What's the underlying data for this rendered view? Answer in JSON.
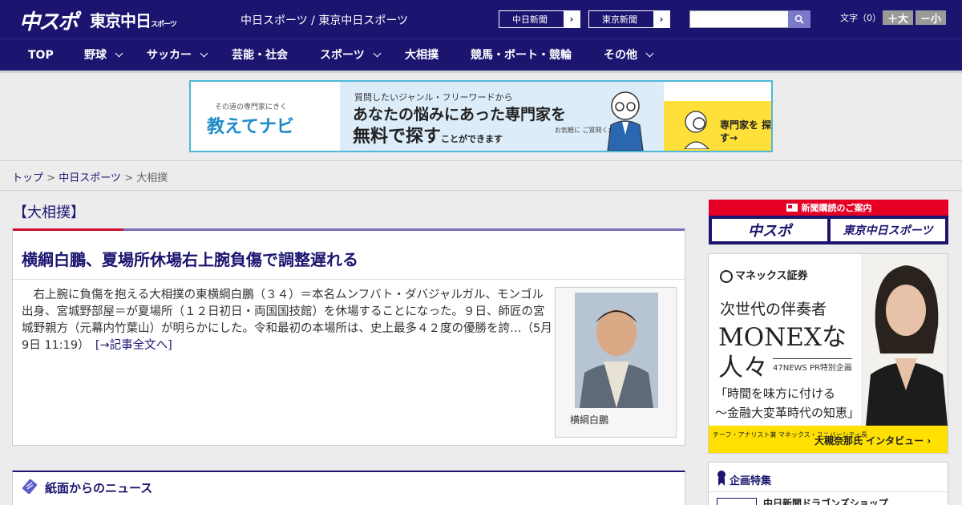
{
  "header": {
    "logo_main": "中スポ",
    "logo_tokyo": "東京中日",
    "logo_tokyo_sub": "スポーツ",
    "site_names": "中日スポーツ / 東京中日スポーツ",
    "btn_chunichi": "中日新聞",
    "btn_tokyo": "東京新聞",
    "search_placeholder": "",
    "fontsize_label": "文字（0）",
    "fontsize_up": "＋大",
    "fontsize_down": "－小"
  },
  "nav": {
    "items": [
      {
        "label": "TOP"
      },
      {
        "label": "野球"
      },
      {
        "label": "サッカー"
      },
      {
        "label": "芸能・社会"
      },
      {
        "label": "スポーツ"
      },
      {
        "label": "大相撲"
      },
      {
        "label": "競馬・ボート・競輪"
      },
      {
        "label": "その他"
      }
    ]
  },
  "banner": {
    "tagline": "その道の専門家にきく",
    "brand": "教えてナビ",
    "line1": "質問したいジャンル・フリーワードから",
    "line2": "あなたの悩みにあった専門家を",
    "line3": "無料で探す",
    "line3_tail": "ことができます",
    "note": "お気軽に ご質問ください!",
    "cta": "専門家を 探す→"
  },
  "breadcrumb": {
    "home": "トップ",
    "section": "中日スポーツ",
    "current": "大相撲",
    "sep": " > "
  },
  "article": {
    "category": "【大相撲】",
    "headline": "横綱白鵬、夏場所休場右上腕負傷で調整遅れる",
    "body": "　右上腕に負傷を抱える大相撲の東横綱白鵬（３４）＝本名ムンフバト・ダバジャルガル、モンゴル出身、宮城野部屋＝が夏場所（１２日初日・両国国技館）を休場することになった。９日、師匠の宮城野親方（元幕内竹葉山）が明らかにした。令和最初の本場所は、史上最多４２度の優勝を誇…（5月9日 11:19）",
    "more_link": "[→記事全文へ]",
    "photo_caption": "横綱白鵬"
  },
  "news_section": {
    "title": "紙面からのニュース"
  },
  "sidebar": {
    "subscribe_title": "新聞購読のご案内",
    "subscribe_btn1": "中スポ",
    "subscribe_btn2": "東京中日スポーツ",
    "ad": {
      "brand": "マネックス証券",
      "t1": "次世代の伴奏者",
      "t2": "MONEXな",
      "t3": "人々",
      "t3_sub": "47NEWS PR特別企画",
      "t4a": "「時間を味方に付ける",
      "t4b": "〜金融大変革時代の知恵」",
      "foot_role": "チーフ・アナリスト兼 マネックス・ユニバーシティ長",
      "foot_name": "大槻奈那氏 インタビュー ›"
    },
    "special_title": "企画特集",
    "special_item": "中日新聞ドラゴンズショップ"
  },
  "colors": {
    "brand_navy": "#1b1570",
    "accent_red": "#c8102e",
    "accent_purple": "#7b6fb6",
    "banner_border": "#4fb8d9",
    "ad_yellow": "#ffe000"
  }
}
